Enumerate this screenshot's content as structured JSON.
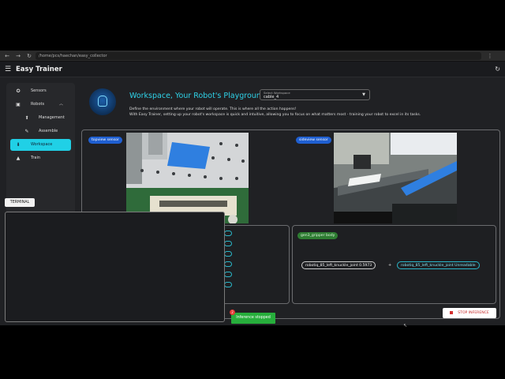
{
  "browser": {
    "url": "/home/pcs/haechan/easy_collector",
    "back_icon": "back-arrow-icon",
    "forward_icon": "forward-arrow-icon",
    "reload_icon": "reload-icon",
    "menu_icon": "kebab-menu-icon"
  },
  "app": {
    "title": "Easy Trainer",
    "menu_icon": "hamburger-icon",
    "refresh_icon": "refresh-icon"
  },
  "sidebar": {
    "items": [
      {
        "label": "Sensors",
        "icon": "sensor-icon",
        "active": false
      },
      {
        "label": "Robots",
        "icon": "robot-icon",
        "active": false,
        "expanded": true
      },
      {
        "label": "Management",
        "icon": "upload-icon",
        "active": false,
        "sub": true
      },
      {
        "label": "Assemble",
        "icon": "wrench-icon",
        "active": false,
        "sub": true
      },
      {
        "label": "Workspace",
        "icon": "download-icon",
        "active": true
      },
      {
        "label": "Train",
        "icon": "graduation-cap-icon",
        "active": false
      }
    ]
  },
  "header": {
    "title": "Workspace, Your Robot's Playground",
    "description_line1": "Define the environment where your robot will operate. This is where all the action happens!",
    "description_line2": "With Easy Trainer, setting up your robot's workspace is quick and intuitive, allowing you to focus on what matters most - training your robot to excel in its tasks."
  },
  "workspace_select": {
    "label": "Select Workspace",
    "value": "cable_4"
  },
  "sensors": {
    "topview_label": "topview sensor",
    "sideview_label": "sideview sensor"
  },
  "gripper": {
    "label": "gen3_gripper body",
    "joint_value_text": "robotiq_85_left_knuckle_joint 0.5973",
    "joint_status_text": "robotiq_85_left_knuckle_joint Unreadable"
  },
  "controls": {
    "stop_label": "STOP INFERENCE"
  },
  "terminal": {
    "tab_label": "TERMINAL"
  },
  "toast": {
    "message": "Inference stopped",
    "badge": "2"
  },
  "colors": {
    "accent": "#20d0e6",
    "title": "#2fd3e9",
    "chip_blue": "#1f5fd1",
    "chip_green": "#2e7d32",
    "toast_green": "#27ae3c",
    "stop_red": "#d32f2f"
  }
}
